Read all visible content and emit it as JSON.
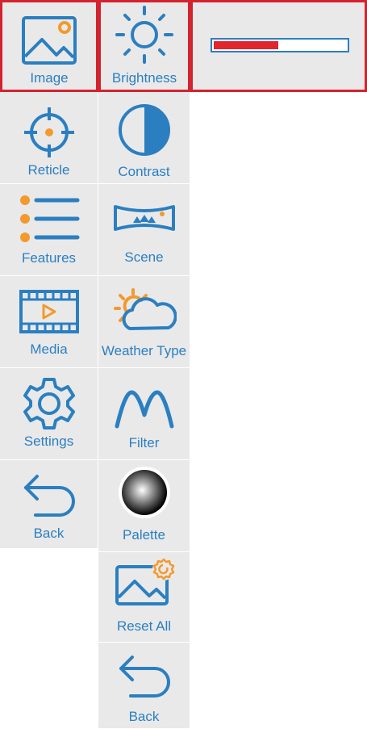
{
  "colors": {
    "accent": "#2b7fc0",
    "highlight": "#f29a2e",
    "selected_border": "#d3232f",
    "slider_fill": "#e1262e"
  },
  "col1": [
    {
      "label": "Image",
      "icon": "image-icon",
      "selected": true
    },
    {
      "label": "Reticle",
      "icon": "reticle-icon"
    },
    {
      "label": "Features",
      "icon": "list-icon"
    },
    {
      "label": "Media",
      "icon": "film-play-icon"
    },
    {
      "label": "Settings",
      "icon": "gear-icon"
    },
    {
      "label": "Back",
      "icon": "back-arrow-icon"
    }
  ],
  "col2": [
    {
      "label": "Brightness",
      "icon": "sun-icon",
      "selected": true
    },
    {
      "label": "Contrast",
      "icon": "contrast-icon"
    },
    {
      "label": "Scene",
      "icon": "panorama-icon"
    },
    {
      "label": "Weather Type",
      "icon": "sun-cloud-icon"
    },
    {
      "label": "Filter",
      "icon": "peaks-icon"
    },
    {
      "label": "Palette",
      "icon": "palette-sphere-icon"
    },
    {
      "label": "Reset All",
      "icon": "image-reset-icon"
    },
    {
      "label": "Back",
      "icon": "back-arrow-icon"
    }
  ],
  "brightness_slider": {
    "value_fraction": 0.5
  }
}
